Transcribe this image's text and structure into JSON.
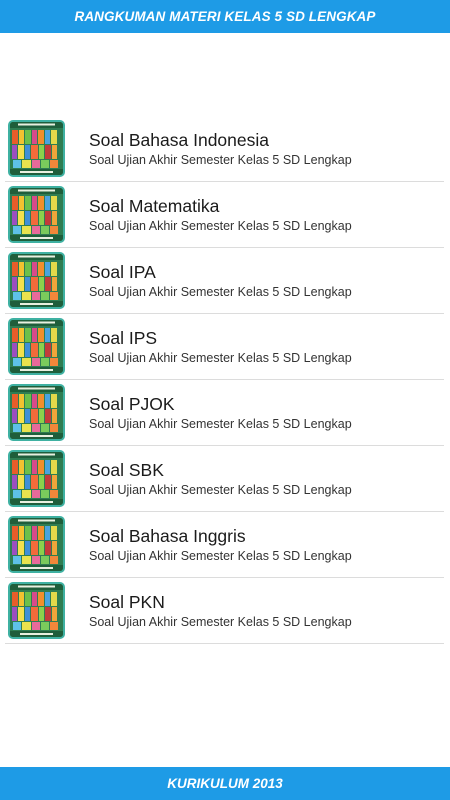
{
  "header": {
    "title": "RANGKUMAN MATERI KELAS 5 SD LENGKAP"
  },
  "footer": {
    "label": "KURIKULUM 2013"
  },
  "colors": {
    "accent": "#1e9be6",
    "thumb_border": "#3fb1a2"
  },
  "items": [
    {
      "title": "Soal Bahasa Indonesia",
      "subtitle": "Soal Ujian Akhir Semester Kelas 5 SD Lengkap",
      "icon": "book-cover-thumbnail"
    },
    {
      "title": "Soal Matematika",
      "subtitle": "Soal Ujian Akhir Semester Kelas 5 SD Lengkap",
      "icon": "book-cover-thumbnail"
    },
    {
      "title": "Soal IPA",
      "subtitle": "Soal Ujian Akhir Semester Kelas 5 SD Lengkap",
      "icon": "book-cover-thumbnail"
    },
    {
      "title": "Soal IPS",
      "subtitle": "Soal Ujian Akhir Semester Kelas 5 SD Lengkap",
      "icon": "book-cover-thumbnail"
    },
    {
      "title": "Soal PJOK",
      "subtitle": "Soal Ujian Akhir Semester Kelas 5 SD Lengkap",
      "icon": "book-cover-thumbnail"
    },
    {
      "title": "Soal SBK",
      "subtitle": "Soal Ujian Akhir Semester Kelas 5 SD Lengkap",
      "icon": "book-cover-thumbnail"
    },
    {
      "title": "Soal Bahasa Inggris",
      "subtitle": "Soal Ujian Akhir Semester Kelas 5 SD Lengkap",
      "icon": "book-cover-thumbnail"
    },
    {
      "title": "Soal PKN",
      "subtitle": "Soal Ujian Akhir Semester Kelas 5 SD Lengkap",
      "icon": "book-cover-thumbnail"
    }
  ]
}
